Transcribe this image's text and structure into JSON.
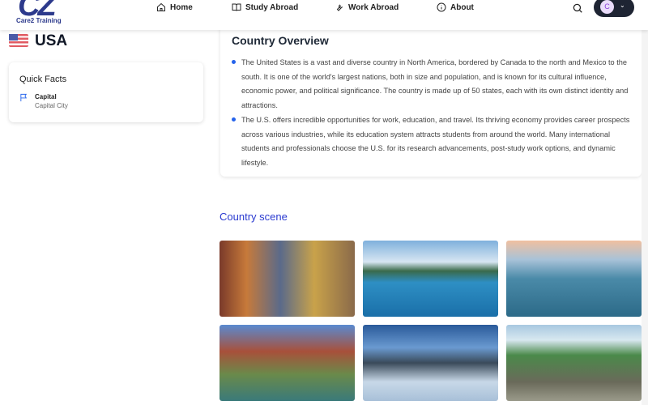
{
  "brand": {
    "logo_text": "Care2 Training"
  },
  "nav": [
    {
      "label": "Home",
      "icon": "home-icon"
    },
    {
      "label": "Study Abroad",
      "icon": "book-icon"
    },
    {
      "label": "Work Abroad",
      "icon": "tools-icon"
    },
    {
      "label": "About",
      "icon": "info-icon"
    }
  ],
  "user": {
    "initial": "C"
  },
  "country": {
    "name": "USA"
  },
  "quick_facts": {
    "title": "Quick Facts",
    "items": [
      {
        "label": "Capital",
        "value": "Capital City"
      }
    ]
  },
  "overview": {
    "title": "Country Overview",
    "paragraphs": [
      "The United States is a vast and diverse country in North America, bordered by Canada to the north and Mexico to the south. It is one of the world's largest nations, both in size and population, and is known for its cultural influence, economic power, and political significance. The country is made up of 50 states, each with its own distinct identity and attractions.",
      "The U.S. offers incredible opportunities for work, education, and travel. Its thriving economy provides career prospects across various industries, while its education system attracts students from around the world. Many international students and professionals choose the U.S. for its research advancements, post-study work options, and dynamic lifestyle."
    ]
  },
  "scene": {
    "title": "Country scene"
  },
  "colors": {
    "accent": "#2563eb",
    "scene_title": "#2a3ad0",
    "user_pill": "#1e2433"
  }
}
